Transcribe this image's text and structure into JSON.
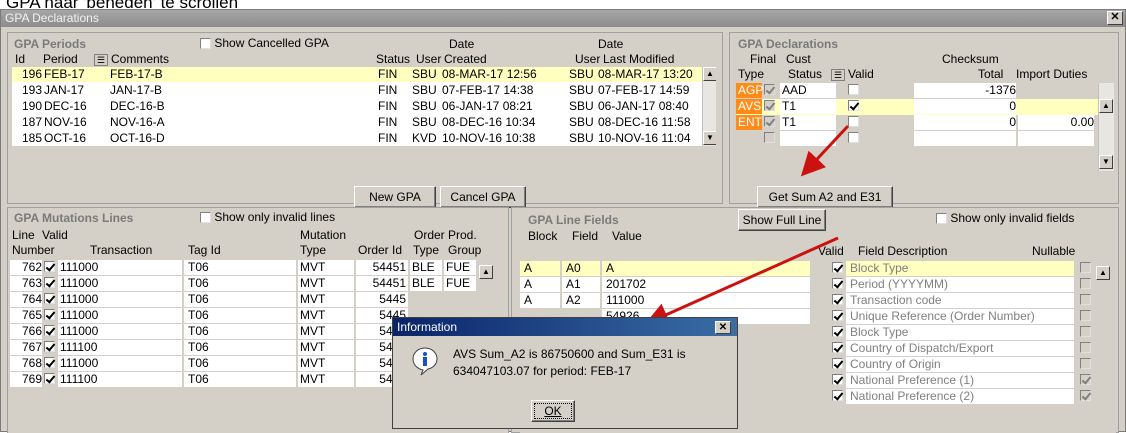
{
  "top_note": "GPA naar 'beneden' te scrollen",
  "window": {
    "title": "GPA Declarations"
  },
  "periods": {
    "title": "GPA Periods",
    "show_cancelled_label": "Show Cancelled GPA",
    "headers": {
      "id": "Id",
      "period": "Period",
      "comments": "Comments",
      "status": "Status",
      "user1": "User",
      "created": "Created",
      "date1": "Date",
      "user2": "User",
      "last_modified": "Last Modified",
      "date2": "Date"
    },
    "rows": [
      {
        "id": "196",
        "period": "FEB-17",
        "comments": "FEB-17-B",
        "status": "FIN",
        "user": "SBU",
        "created": "08-MAR-17 12:56",
        "user2": "SBU",
        "modified": "08-MAR-17 13:20",
        "selected": true
      },
      {
        "id": "193",
        "period": "JAN-17",
        "comments": "JAN-17-B",
        "status": "FIN",
        "user": "SBU",
        "created": "07-FEB-17 14:38",
        "user2": "SBU",
        "modified": "07-FEB-17 14:59",
        "selected": false
      },
      {
        "id": "190",
        "period": "DEC-16",
        "comments": "DEC-16-B",
        "status": "FIN",
        "user": "SBU",
        "created": "06-JAN-17 08:21",
        "user2": "SBU",
        "modified": "06-JAN-17 08:40",
        "selected": false
      },
      {
        "id": "187",
        "period": "NOV-16",
        "comments": "NOV-16-A",
        "status": "FIN",
        "user": "SBU",
        "created": "08-DEC-16 10:34",
        "user2": "SBU",
        "modified": "08-DEC-16 11:58",
        "selected": false
      },
      {
        "id": "185",
        "period": "OCT-16",
        "comments": "OCT-16-D",
        "status": "FIN",
        "user": "KVD",
        "created": "10-NOV-16 10:38",
        "user2": "SBU",
        "modified": "10-NOV-16 11:04",
        "selected": false
      }
    ],
    "new_gpa_label": "New GPA",
    "cancel_gpa_label": "Cancel GPA"
  },
  "declarations": {
    "title": "GPA Declarations",
    "headers": {
      "final": "Final",
      "cust": "Cust",
      "checksum": "Checksum",
      "type": "Type",
      "status": "Status",
      "valid": "Valid",
      "total": "Total",
      "import_duties": "Import Duties"
    },
    "rows": [
      {
        "type": "AGP",
        "final": true,
        "status": "AAD",
        "valid": false,
        "total": "-1376",
        "duties": "",
        "selected": false
      },
      {
        "type": "AVS",
        "final": true,
        "status": "T1",
        "valid": true,
        "total": "0",
        "duties": "",
        "selected": true
      },
      {
        "type": "ENT",
        "final": true,
        "status": "T1",
        "valid": false,
        "total": "0",
        "duties": "0.00",
        "selected": false
      }
    ],
    "get_sum_label": "Get Sum A2 and E31"
  },
  "mutations": {
    "title": "GPA Mutations Lines",
    "show_invalid_label": "Show only invalid lines",
    "headers": {
      "line": "Line",
      "valid": "Valid",
      "number": "Number",
      "transaction": "Transaction",
      "tag_id": "Tag Id",
      "mutation": "Mutation",
      "type": "Type",
      "order": "Order",
      "order_id": "Order Id",
      "order_type": "Type",
      "prod": "Prod.",
      "group": "Group"
    },
    "rows": [
      {
        "number": "762",
        "valid": true,
        "transaction": "111000",
        "tag": "T06",
        "type": "MVT",
        "order_id": "54451",
        "otype": "BLE",
        "group": "FUE"
      },
      {
        "number": "763",
        "valid": true,
        "transaction": "111000",
        "tag": "T06",
        "type": "MVT",
        "order_id": "54451",
        "otype": "BLE",
        "group": "FUE"
      },
      {
        "number": "764",
        "valid": true,
        "transaction": "111000",
        "tag": "T06",
        "type": "MVT",
        "order_id": "5445",
        "otype": "",
        "group": ""
      },
      {
        "number": "765",
        "valid": true,
        "transaction": "111000",
        "tag": "T06",
        "type": "MVT",
        "order_id": "5445",
        "otype": "",
        "group": ""
      },
      {
        "number": "766",
        "valid": true,
        "transaction": "111000",
        "tag": "T06",
        "type": "MVT",
        "order_id": "5445",
        "otype": "",
        "group": ""
      },
      {
        "number": "767",
        "valid": true,
        "transaction": "111100",
        "tag": "T06",
        "type": "MVT",
        "order_id": "5445",
        "otype": "",
        "group": ""
      },
      {
        "number": "768",
        "valid": true,
        "transaction": "111000",
        "tag": "T06",
        "type": "MVT",
        "order_id": "5445",
        "otype": "",
        "group": ""
      },
      {
        "number": "769",
        "valid": true,
        "transaction": "111100",
        "tag": "T06",
        "type": "MVT",
        "order_id": "5445",
        "otype": "",
        "group": ""
      }
    ]
  },
  "line_fields": {
    "title": "GPA Line Fields",
    "show_full_line_label": "Show Full Line",
    "show_invalid_label": "Show only invalid fields",
    "headers": {
      "block": "Block",
      "field": "Field",
      "value": "Value",
      "valid": "Valid",
      "description": "Field Description",
      "nullable": "Nullable"
    },
    "rows": [
      {
        "block": "A",
        "field": "A0",
        "value": "A",
        "valid": true,
        "desc": "Block Type",
        "nullable": false,
        "selected": true
      },
      {
        "block": "A",
        "field": "A1",
        "value": "201702",
        "valid": true,
        "desc": "Period (YYYYMM)",
        "nullable": false,
        "selected": false
      },
      {
        "block": "A",
        "field": "A2",
        "value": "111000",
        "valid": true,
        "desc": "Transaction code",
        "nullable": false,
        "selected": false
      },
      {
        "block": "",
        "field": "",
        "value": "54926",
        "valid": true,
        "desc": "Unique Reference (Order Number)",
        "nullable": false,
        "selected": false
      },
      {
        "block": "",
        "field": "",
        "value": "",
        "valid": true,
        "desc": "Block Type",
        "nullable": false,
        "selected": false
      },
      {
        "block": "",
        "field": "",
        "value": "",
        "valid": true,
        "desc": "Country of Dispatch/Export",
        "nullable": false,
        "selected": false
      },
      {
        "block": "",
        "field": "",
        "value": "",
        "valid": true,
        "desc": "Country of Origin",
        "nullable": false,
        "selected": false
      },
      {
        "block": "",
        "field": "",
        "value": "",
        "valid": true,
        "desc": "National Preference (1)",
        "nullable": true,
        "selected": false
      },
      {
        "block": "",
        "field": "",
        "value": "",
        "valid": true,
        "desc": "National Preference (2)",
        "nullable": true,
        "selected": false
      }
    ]
  },
  "dialog": {
    "title": "Information",
    "message_line1": "AVS Sum_A2 is 86750600 and Sum_E31 is",
    "message_line2": "634047103.07 for period: FEB-17",
    "ok_label": "OK"
  },
  "colors": {
    "highlight_row": "#ffffc0",
    "orange_type": "#ff8c1a",
    "arrow": "#cc1111",
    "dialog_title": "#0a246a"
  }
}
